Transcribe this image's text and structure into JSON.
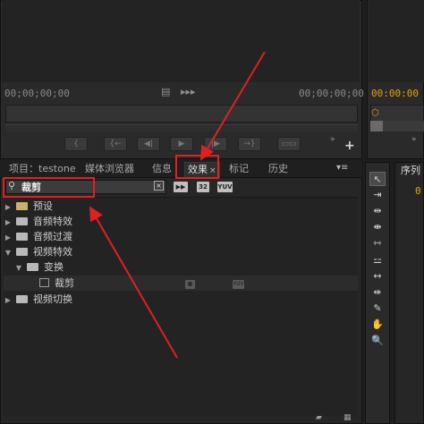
{
  "source_monitor": {
    "timecode_left": "00;00;00;00",
    "timecode_right": "00;00;00;00",
    "film_icon": "▤",
    "audio_icon": "▸▸▸",
    "transport": [
      "{",
      "{←",
      "◀|",
      "▶",
      "|▶",
      "→}",
      "▭▭"
    ],
    "more_icon": "»",
    "add_icon": "+"
  },
  "program_monitor": {
    "timecode": "00:00:00",
    "more_icon": "»"
  },
  "effects_panel": {
    "tabs": [
      "项目：testone",
      "媒体浏览器",
      "信息",
      "效果",
      "标记",
      "历史"
    ],
    "tab_close": "×",
    "menu_icon": "▾≡",
    "search_value": "裁剪",
    "search_icon": "⚲",
    "clear_icon": "×",
    "filter_buttons": [
      "▶▶",
      "32",
      "YUV"
    ],
    "tree": [
      {
        "label": "预设",
        "level": 0,
        "expanded": false,
        "kind": "preset"
      },
      {
        "label": "音频特效",
        "level": 0,
        "expanded": false,
        "kind": "folder"
      },
      {
        "label": "音频过渡",
        "level": 0,
        "expanded": false,
        "kind": "folder"
      },
      {
        "label": "视频特效",
        "level": 0,
        "expanded": true,
        "kind": "folder"
      },
      {
        "label": "变换",
        "level": 1,
        "expanded": true,
        "kind": "folder"
      },
      {
        "label": "裁剪",
        "level": 2,
        "expanded": false,
        "kind": "effect"
      },
      {
        "label": "视频切换",
        "level": 0,
        "expanded": false,
        "kind": "folder"
      }
    ],
    "badge_labels": [
      "▦",
      "YUV"
    ]
  },
  "tools": [
    "↖",
    "⇥",
    "⇹",
    "⇼",
    "⇿",
    "⚍",
    "↔",
    "⇺",
    "✎",
    "✋",
    "🔍"
  ],
  "timeline": {
    "tab": "序列",
    "timecode": "0"
  },
  "colors": {
    "accent_timecode": "#e8a000",
    "annotation": "#e02020"
  }
}
